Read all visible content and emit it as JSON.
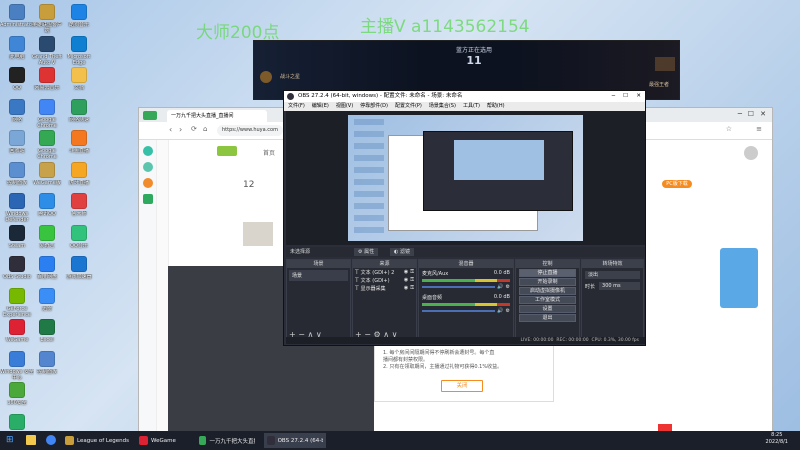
{
  "overlay": {
    "watermark1": "大师200点",
    "watermark2": "主播V a1143562154"
  },
  "desktop_icons": [
    {
      "label": "Administrator",
      "color": "#4a7fc1"
    },
    {
      "label": "此电脑",
      "color": "#3f86d6"
    },
    {
      "label": "QQ",
      "color": "#222"
    },
    {
      "label": "网络",
      "color": "#3b78c4"
    },
    {
      "label": "回收站",
      "color": "#7aa7d6"
    },
    {
      "label": "控制面板",
      "color": "#5b8fcf"
    },
    {
      "label": "Windows Defender",
      "color": "#2b66b4"
    },
    {
      "label": "Steam",
      "color": "#1b2838"
    },
    {
      "label": "OBS Studio",
      "color": "#302e3a"
    },
    {
      "label": "GeForce Experience",
      "color": "#76b900"
    },
    {
      "label": "WeGame",
      "color": "#d23"
    },
    {
      "label": "Windows 安全中心",
      "color": "#3a7dd8"
    },
    {
      "label": "360安全",
      "color": "#4ba83a"
    },
    {
      "label": "微信",
      "color": "#2aae67"
    }
  ],
  "desktop_icons_col2": [
    {
      "label": "英雄联盟客户端",
      "color": "#c79e3b"
    },
    {
      "label": "Grand Theft Auto V",
      "color": "#2a4b6f"
    },
    {
      "label": "网易云音乐",
      "color": "#d33"
    },
    {
      "label": "Google Chrome",
      "color": "#4285f4"
    },
    {
      "label": "Google Chrome",
      "color": "#34a853"
    },
    {
      "label": "WeGame版",
      "color": "#c8a24a"
    },
    {
      "label": "腾讯QQ",
      "color": "#2e8de6"
    },
    {
      "label": "爱奇艺",
      "color": "#39c440"
    },
    {
      "label": "百度网盘",
      "color": "#2b7ff0"
    },
    {
      "label": "迅雷",
      "color": "#3a8ef6"
    },
    {
      "label": "Excel",
      "color": "#1f7a45"
    },
    {
      "label": "控制面板",
      "color": "#5386cf"
    }
  ],
  "desktop_icons_col3": [
    {
      "label": "酷狗音乐",
      "color": "#1d84e6"
    },
    {
      "label": "Microsoft Edge",
      "color": "#0f7fd2"
    },
    {
      "label": "文档",
      "color": "#f3c14b"
    },
    {
      "label": "网络测速",
      "color": "#2f9f5e"
    },
    {
      "label": "斗鱼直播",
      "color": "#f47820"
    },
    {
      "label": "虎牙直播",
      "color": "#f5a623"
    },
    {
      "label": "鲁大师",
      "color": "#e04040"
    },
    {
      "label": "QQ音乐",
      "color": "#31c27c"
    },
    {
      "label": "游戏加速器",
      "color": "#1b76d2"
    }
  ],
  "lol": {
    "title": "蓝方正在选用",
    "timer": "11",
    "label_left": "战斗之星",
    "label_right": "最强王者"
  },
  "browser": {
    "tab_title": "一万九千把大头直播_直播间",
    "url": "https://www.huya.com",
    "nav_home": "首页",
    "count": "12",
    "badge": "PC版下载",
    "dialog_lines": [
      "1. 每个房间间隔期间得不停刷新会遭封号。每个直",
      "播间都有封禁权限。",
      "2. 只有在领取期间，主播通过礼物可获得0.1%收益。"
    ],
    "dialog_button": "关闭"
  },
  "obs": {
    "title": "OBS 27.2.4 (64-bit, windows) - 配置文件: 未命名 - 场景: 未命名",
    "menu": [
      "文件(F)",
      "编辑(E)",
      "视图(V)",
      "停靠部件(D)",
      "配置文件(P)",
      "场景集合(S)",
      "工具(T)",
      "帮助(H)"
    ],
    "no_source": "未选择源",
    "properties": "属性",
    "filters": "滤镜",
    "docks": {
      "scenes": "场景",
      "sources": "来源",
      "mixer": "混音器",
      "transitions": "转场特效",
      "controls": "控制"
    },
    "scene_item": "场景",
    "sources": [
      "文本 (GDI+) 2",
      "文本 (GDI+)",
      "显示器采集"
    ],
    "mixer": [
      {
        "name": "麦克风/Aux",
        "db": "0.0 dB"
      },
      {
        "name": "桌面音频",
        "db": "0.0 dB"
      }
    ],
    "controls": [
      "停止直播",
      "开始录制",
      "启动虚拟摄像机",
      "工作室模式",
      "设置",
      "退出"
    ],
    "transition": "淡出",
    "duration_label": "时长",
    "duration": "300 ms",
    "status": {
      "live": "LIVE: 00:00:00",
      "rec": "REC: 00:00:00",
      "cpu": "CPU: 0.3%, 30.00 fps"
    }
  },
  "taskbar": {
    "items": [
      "League of Legends",
      "WeGame",
      "一万九千把大头直播...",
      "OBS 27.2.4 (64-bi..."
    ],
    "time": "8:25",
    "date": "2022/8/1"
  }
}
